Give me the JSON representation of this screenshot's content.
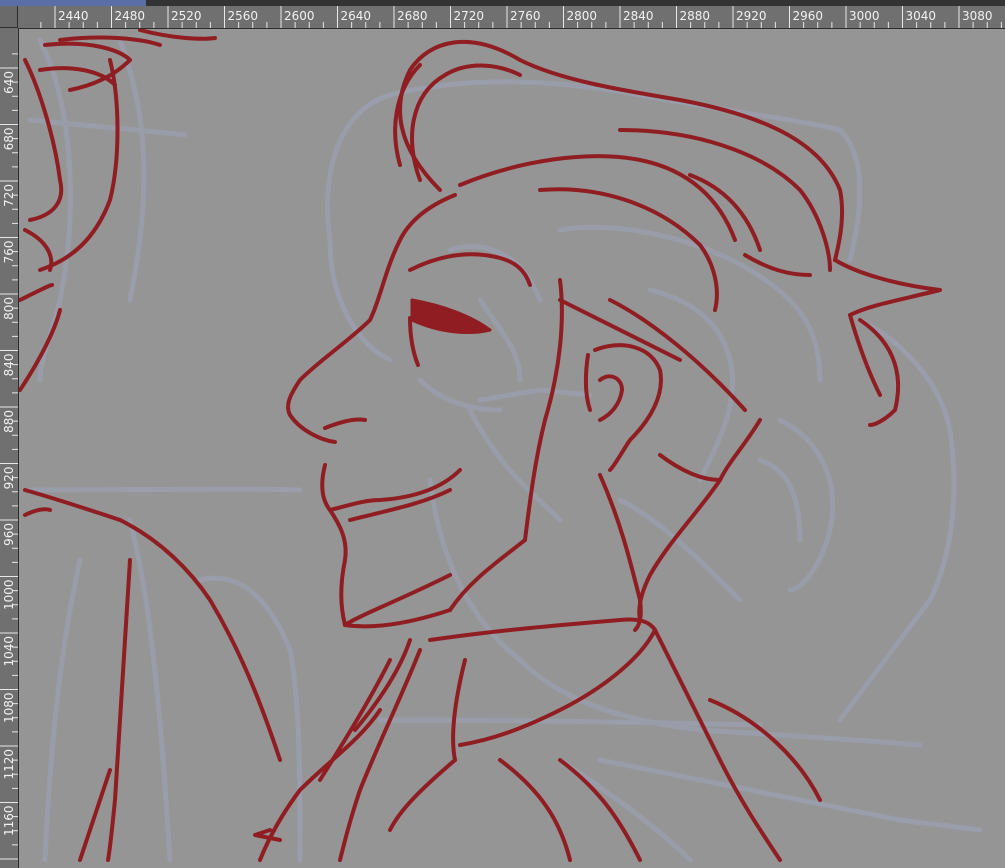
{
  "ruler": {
    "horizontal_labels": [
      "2440",
      "2480",
      "2520",
      "2560",
      "2600",
      "2640",
      "2680",
      "2720",
      "2760",
      "2800",
      "2840",
      "2880",
      "2920",
      "2960",
      "3000",
      "3040",
      "3080"
    ],
    "vertical_labels": [
      "640",
      "680",
      "720",
      "760",
      "800",
      "840",
      "880",
      "920",
      "960",
      "1000",
      "1040",
      "1080",
      "1120",
      "1160"
    ]
  },
  "canvas": {
    "background": "#959595",
    "sketch_line_color": "#8f1d22",
    "rough_layer_color": "#9b9fb0"
  }
}
